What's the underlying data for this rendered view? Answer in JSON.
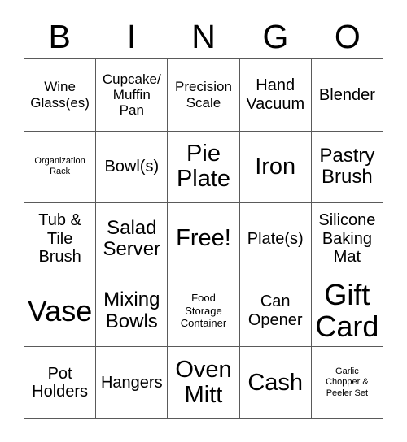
{
  "card": {
    "title": "BINGO",
    "header_letters": [
      "B",
      "I",
      "N",
      "G",
      "O"
    ],
    "columns": 5,
    "rows": 5,
    "colors": {
      "background": "#ffffff",
      "text": "#000000",
      "grid_line": "#5a5a5a"
    },
    "free_space": {
      "label": "Free!",
      "row": 3,
      "column": 3
    },
    "squares": [
      {
        "text": "Wine\nGlass(es)",
        "size": "sm",
        "row": 1,
        "col": 1
      },
      {
        "text": "Cupcake/\nMuffin\nPan",
        "size": "sm",
        "row": 1,
        "col": 2
      },
      {
        "text": "Precision\nScale",
        "size": "sm",
        "row": 1,
        "col": 3
      },
      {
        "text": "Hand\nVacuum",
        "size": "md",
        "row": 1,
        "col": 4
      },
      {
        "text": "Blender",
        "size": "md",
        "row": 1,
        "col": 5
      },
      {
        "text": "Organization\nRack",
        "size": "xxs",
        "row": 2,
        "col": 1
      },
      {
        "text": "Bowl(s)",
        "size": "md",
        "row": 2,
        "col": 2
      },
      {
        "text": "Pie\nPlate",
        "size": "xl",
        "row": 2,
        "col": 3
      },
      {
        "text": "Iron",
        "size": "xl",
        "row": 2,
        "col": 4
      },
      {
        "text": "Pastry\nBrush",
        "size": "lg",
        "row": 2,
        "col": 5
      },
      {
        "text": "Tub &\nTile\nBrush",
        "size": "md",
        "row": 3,
        "col": 1
      },
      {
        "text": "Salad\nServer",
        "size": "lg",
        "row": 3,
        "col": 2
      },
      {
        "text": "Free!",
        "size": "xl",
        "row": 3,
        "col": 3
      },
      {
        "text": "Plate(s)",
        "size": "md",
        "row": 3,
        "col": 4
      },
      {
        "text": "Silicone\nBaking\nMat",
        "size": "md",
        "row": 3,
        "col": 5
      },
      {
        "text": "Vase",
        "size": "xxl",
        "row": 4,
        "col": 1
      },
      {
        "text": "Mixing\nBowls",
        "size": "lg",
        "row": 4,
        "col": 2
      },
      {
        "text": "Food\nStorage\nContainer",
        "size": "xs",
        "row": 4,
        "col": 3
      },
      {
        "text": "Can\nOpener",
        "size": "md",
        "row": 4,
        "col": 4
      },
      {
        "text": "Gift\nCard",
        "size": "xxl",
        "row": 4,
        "col": 5
      },
      {
        "text": "Pot\nHolders",
        "size": "md",
        "row": 5,
        "col": 1
      },
      {
        "text": "Hangers",
        "size": "md",
        "row": 5,
        "col": 2
      },
      {
        "text": "Oven\nMitt",
        "size": "xl",
        "row": 5,
        "col": 3
      },
      {
        "text": "Cash",
        "size": "xl",
        "row": 5,
        "col": 4
      },
      {
        "text": "Garlic\nChopper &\nPeeler Set",
        "size": "xxs",
        "row": 5,
        "col": 5
      }
    ]
  }
}
